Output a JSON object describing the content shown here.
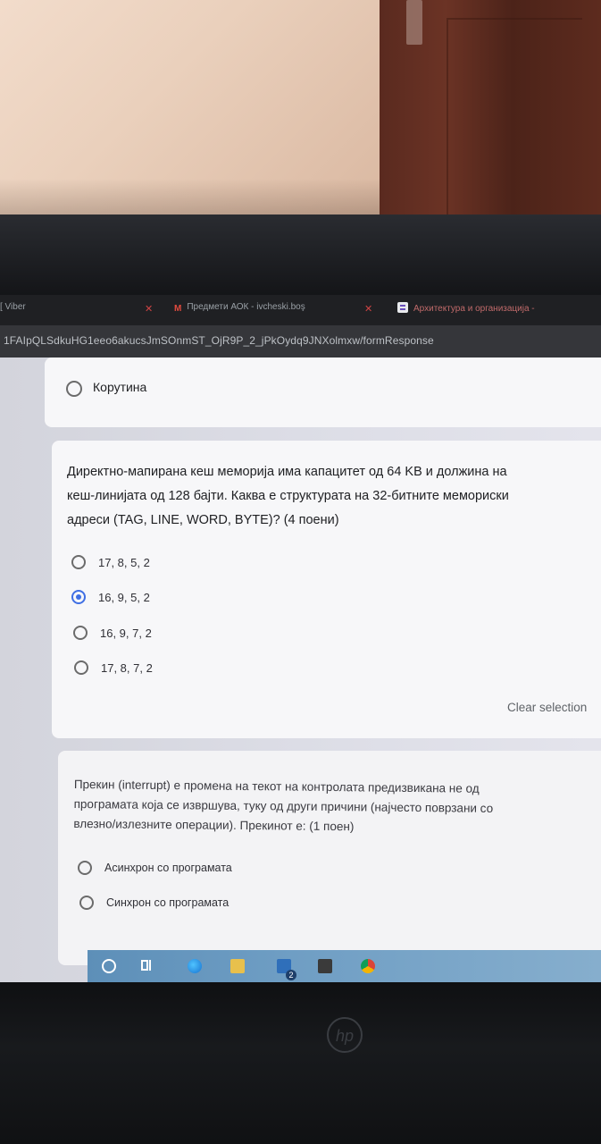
{
  "browser": {
    "tabs": [
      {
        "label": "[ Viber"
      },
      {
        "icon": "M",
        "label": "Предмети АОК - ivcheski.boş"
      },
      {
        "icon": "forms-icon",
        "label": "Архитектура и организација -"
      }
    ],
    "url": "1FAIpQLSdkuHG1eeo6akucsJmSOnmST_OjR9P_2_jPkOydq9JNXolmxw/formResponse"
  },
  "form": {
    "prev_option": "Корутина",
    "question1": {
      "text": "Директно-мапирана кеш меморија има капацитет од 64 KB и должина на кеш-линијата од 128 бајти. Каква е структурата на 32-битните мемориски адреси (TAG, LINE, WORD, BYTE)? (4 поени)",
      "lines": [
        "Директно-мапирана кеш меморија има капацитет од 64 KB и должина на",
        "кеш-линијата од 128 бајти. Каква е структурата на 32-битните мемориски",
        "адреси (TAG, LINE, WORD, BYTE)? (4 поени)"
      ],
      "options": [
        "17, 8, 5, 2",
        "16, 9, 5, 2",
        "16, 9, 7, 2",
        "17, 8, 7, 2"
      ],
      "selected": "16, 9, 5, 2",
      "clear_label": "Clear selection"
    },
    "question2": {
      "lines": [
        "Прекин (interrupt) е промена на текот на контролата предизвикана не од",
        "програмата која се извршува, туку од други причини (најчесто поврзани со",
        "влезно/излезните операции). Прекинот е: (1 поен)"
      ],
      "options": [
        "Асинхрон со програмата",
        "Синхрон со програмата"
      ]
    }
  },
  "taskbar": {
    "icons": [
      "cortana-icon",
      "task-view-icon",
      "edge-icon",
      "file-explorer-icon",
      "mail-icon",
      "store-icon",
      "chrome-icon"
    ],
    "mail_badge": "2"
  },
  "laptop": {
    "brand": "hp"
  },
  "colors": {
    "accent": "#3f6fe4",
    "taskbar": "#6f9ec4"
  }
}
